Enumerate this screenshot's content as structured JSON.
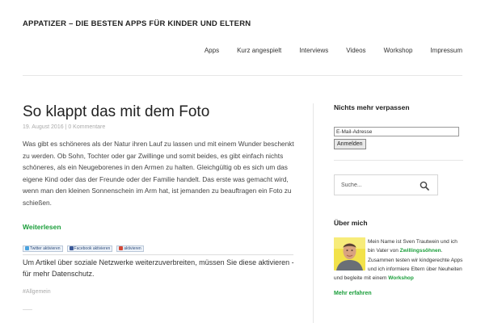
{
  "site": {
    "title": "APPATIZER – DIE BESTEN APPS FÜR KINDER UND ELTERN"
  },
  "nav": {
    "items": [
      {
        "label": "Apps"
      },
      {
        "label": "Kurz angespielt"
      },
      {
        "label": "Interviews"
      },
      {
        "label": "Videos"
      },
      {
        "label": "Workshop"
      },
      {
        "label": "Impressum"
      }
    ]
  },
  "post": {
    "title": "So klappt das mit dem Foto",
    "date": "19. August 2016",
    "meta_sep": "|",
    "comments": "0 Kommentare",
    "body": "Was gibt es schöneres als der Natur ihren Lauf zu lassen und mit einem Wunder beschenkt zu werden. Ob Sohn, Tochter oder gar Zwillinge und somit beides, es gibt einfach nichts schöneres, als ein Neugeborenes in den Armen zu halten. Gleichgültig ob es sich um das eigene Kind oder das der Freunde oder der Familie handelt. Das erste was gemacht wird, wenn man den kleinen Sonnenschein im Arm hat, ist jemanden zu beauftragen ein Foto zu schießen.",
    "read_more": "Weiterlesen",
    "share": {
      "twitter": "Twitter aktivieren",
      "facebook": "Facebook aktivieren",
      "gplus": "aktivieren",
      "note": "Um Artikel über soziale Netzwerke weiterzuverbreiten, müssen Sie diese aktivieren - für mehr Datenschutz."
    },
    "tag": "#Allgemein"
  },
  "sidebar": {
    "newsletter": {
      "title": "Nichts mehr verpassen",
      "email_placeholder": "E-Mail-Adresse",
      "submit_label": "Anmelden"
    },
    "search": {
      "placeholder": "Suche..."
    },
    "about": {
      "title": "Über mich",
      "text_1": "Mein Name ist Sven Trautwein und ich bin Vater von ",
      "highlight_1": "Zwillingssöhnen",
      "text_2": ". Zusammen testen wir kindgerechte Apps und ich informiere Eltern über Neuheiten und begleite mit einem ",
      "highlight_2": "Workshop",
      "more_label": "Mehr erfahren"
    }
  },
  "colors": {
    "accent_green": "#1a9e3a",
    "text": "#333333",
    "muted": "#aaaaaa"
  }
}
